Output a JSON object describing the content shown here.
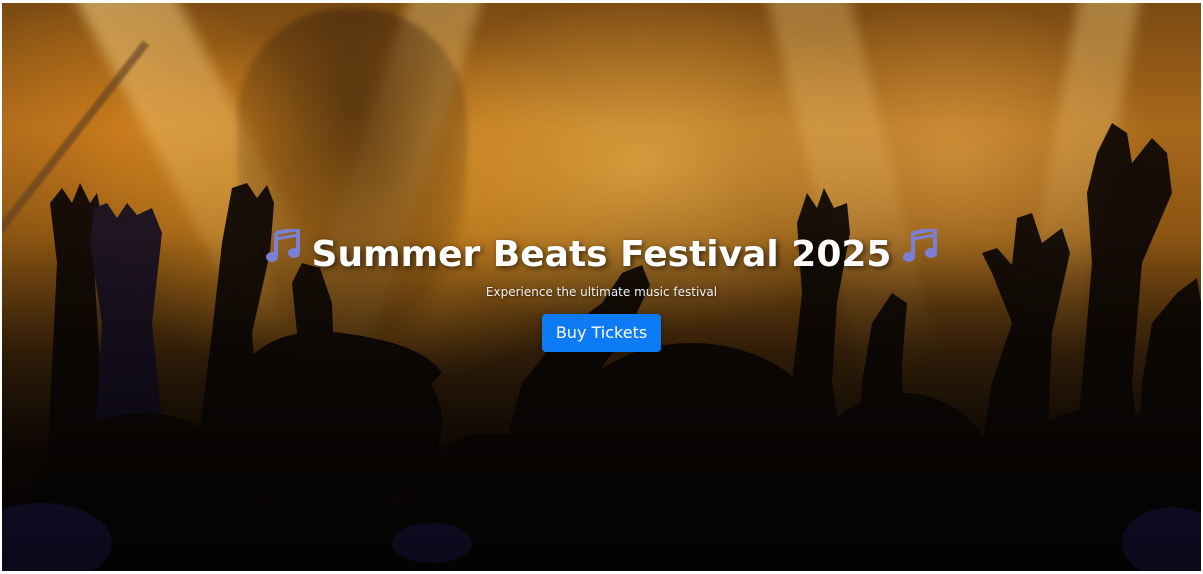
{
  "hero": {
    "title": "Summer Beats Festival 2025",
    "subtitle": "Experience the ultimate music festival",
    "cta_label": "Buy Tickets",
    "left_icon": "music-notes-icon",
    "right_icon": "music-notes-icon"
  },
  "colors": {
    "accent": "#0d7bf5",
    "text": "#ffffff",
    "note": "#7b7fd6"
  }
}
